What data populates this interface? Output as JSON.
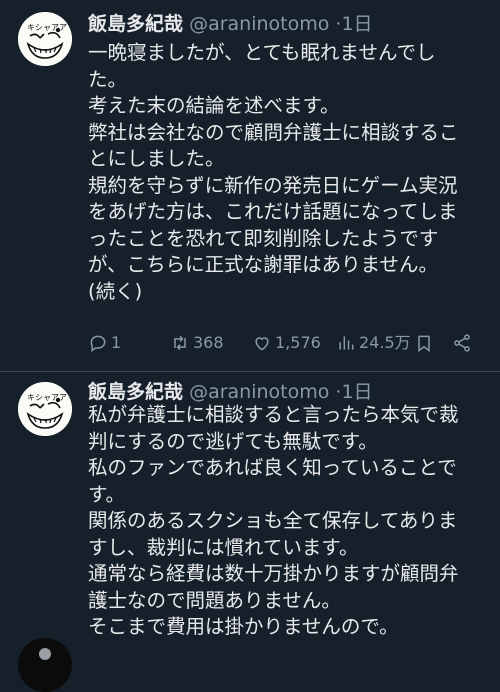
{
  "tweets": [
    {
      "display_name": "飯島多紀哉",
      "handle": "@araninotomo",
      "separator": "·",
      "time": "1日",
      "avatar_text": "キシャアア",
      "lines": [
        "一晩寝ましたが、とても眠れませんでし",
        "た。",
        "考えた末の結論を述べます。",
        "弊社は会社なので顧問弁護士に相談するこ",
        "とにしました。",
        "規約を守らずに新作の発売日にゲーム実況",
        "をあげた方は、これだけ話題になってしま",
        "ったことを恐れて即刻削除したようです",
        "が、こちらに正式な謝罪はありません。",
        "(続く)"
      ],
      "actions": {
        "reply_count": "1",
        "retweet_count": "368",
        "like_count": "1,576",
        "view_count": "24.5万"
      },
      "icons": [
        "reply-icon",
        "retweet-icon",
        "like-icon",
        "views-icon",
        "bookmark-icon",
        "share-icon"
      ]
    },
    {
      "display_name": "飯島多紀哉",
      "handle": "@araninotomo",
      "separator": "·",
      "time": "1日",
      "avatar_text": "キシャアア",
      "lines": [
        "私が弁護士に相談すると言ったら本気で裁",
        "判にするので逃げても無駄です。",
        "私のファンであれば良く知っていることで",
        "す。",
        "関係のあるスクショも全て保存してありま",
        "すし、裁判には慣れています。",
        "通常なら経費は数十万掛かりますが顧問弁",
        "護士なので問題ありません。",
        "そこまで費用は掛かりませんので。"
      ]
    }
  ],
  "colors": {
    "background": "#15202b",
    "text": "#e7e9ea",
    "muted": "#8b98a5",
    "divider": "#38444d"
  }
}
